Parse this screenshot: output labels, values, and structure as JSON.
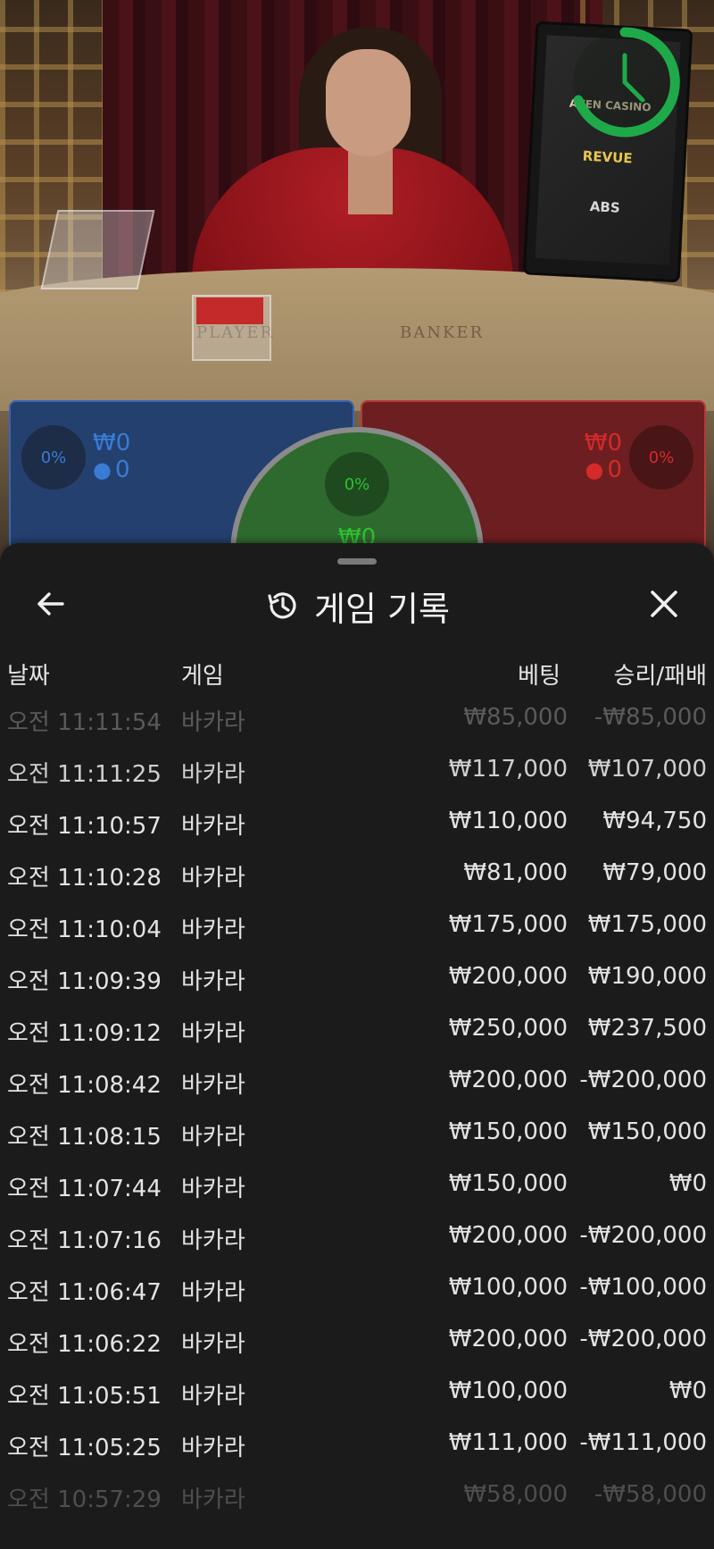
{
  "scene": {
    "table_labels": [
      "PLAYER",
      "BANKER"
    ],
    "monitor_brands": [
      "AVEN CASINO",
      "REVUE",
      "ABS"
    ]
  },
  "betting": {
    "player": {
      "percent": "0%",
      "amount": "₩0",
      "players": "0",
      "color": "#3a7bd5"
    },
    "banker": {
      "percent": "0%",
      "amount": "₩0",
      "players": "0",
      "color": "#d42a2a"
    },
    "tie": {
      "percent": "0%",
      "amount": "₩0",
      "color": "#2ec02e"
    }
  },
  "history": {
    "title": "게임 기록",
    "columns": {
      "date": "날짜",
      "game": "게임",
      "bet": "베팅",
      "result": "승리/패배"
    },
    "rows": [
      {
        "date": "오전 11:11:54",
        "game": "바카라",
        "bet": "₩85,000",
        "result": "-₩85,000"
      },
      {
        "date": "오전 11:11:25",
        "game": "바카라",
        "bet": "₩117,000",
        "result": "₩107,000"
      },
      {
        "date": "오전 11:10:57",
        "game": "바카라",
        "bet": "₩110,000",
        "result": "₩94,750"
      },
      {
        "date": "오전 11:10:28",
        "game": "바카라",
        "bet": "₩81,000",
        "result": "₩79,000"
      },
      {
        "date": "오전 11:10:04",
        "game": "바카라",
        "bet": "₩175,000",
        "result": "₩175,000"
      },
      {
        "date": "오전 11:09:39",
        "game": "바카라",
        "bet": "₩200,000",
        "result": "₩190,000"
      },
      {
        "date": "오전 11:09:12",
        "game": "바카라",
        "bet": "₩250,000",
        "result": "₩237,500"
      },
      {
        "date": "오전 11:08:42",
        "game": "바카라",
        "bet": "₩200,000",
        "result": "-₩200,000"
      },
      {
        "date": "오전 11:08:15",
        "game": "바카라",
        "bet": "₩150,000",
        "result": "₩150,000"
      },
      {
        "date": "오전 11:07:44",
        "game": "바카라",
        "bet": "₩150,000",
        "result": "₩0"
      },
      {
        "date": "오전 11:07:16",
        "game": "바카라",
        "bet": "₩200,000",
        "result": "-₩200,000"
      },
      {
        "date": "오전 11:06:47",
        "game": "바카라",
        "bet": "₩100,000",
        "result": "-₩100,000"
      },
      {
        "date": "오전 11:06:22",
        "game": "바카라",
        "bet": "₩200,000",
        "result": "-₩200,000"
      },
      {
        "date": "오전 11:05:51",
        "game": "바카라",
        "bet": "₩100,000",
        "result": "₩0"
      },
      {
        "date": "오전 11:05:25",
        "game": "바카라",
        "bet": "₩111,000",
        "result": "-₩111,000"
      },
      {
        "date": "오전 10:57:29",
        "game": "바카라",
        "bet": "₩58,000",
        "result": "-₩58,000"
      }
    ]
  },
  "icons": {
    "back": "arrow-left-icon",
    "history": "history-icon",
    "close": "close-icon",
    "timer": "clock-icon"
  },
  "colors": {
    "sheet_bg": "#1b1b1b",
    "timer_green": "#1faa4a"
  }
}
